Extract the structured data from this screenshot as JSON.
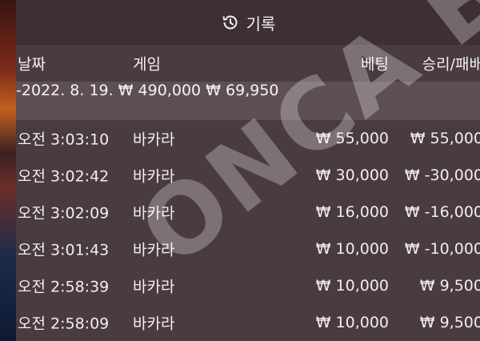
{
  "header": {
    "title": "기록",
    "icon": "history-clock-icon"
  },
  "columns": {
    "date": "날짜",
    "game": "게임",
    "bet": "베팅",
    "winloss": "승리/패배"
  },
  "summary": {
    "date": "-2022. 8. 19.",
    "bet": "₩ 490,000",
    "winloss": "₩ 69,950"
  },
  "rows": [
    {
      "time": "오전 3:03:10",
      "game": "바카라",
      "bet": "₩ 55,000",
      "winloss": "₩ 55,000"
    },
    {
      "time": "오전 3:02:42",
      "game": "바카라",
      "bet": "₩ 30,000",
      "winloss": "₩ -30,000"
    },
    {
      "time": "오전 3:02:09",
      "game": "바카라",
      "bet": "₩ 16,000",
      "winloss": "₩ -16,000"
    },
    {
      "time": "오전 3:01:43",
      "game": "바카라",
      "bet": "₩ 10,000",
      "winloss": "₩ -10,000"
    },
    {
      "time": "오전 2:58:39",
      "game": "바카라",
      "bet": "₩ 10,000",
      "winloss": "₩ 9,500"
    },
    {
      "time": "오전 2:58:09",
      "game": "바카라",
      "bet": "₩ 10,000",
      "winloss": "₩ 9,500"
    }
  ],
  "watermark": "ONCA BEST"
}
